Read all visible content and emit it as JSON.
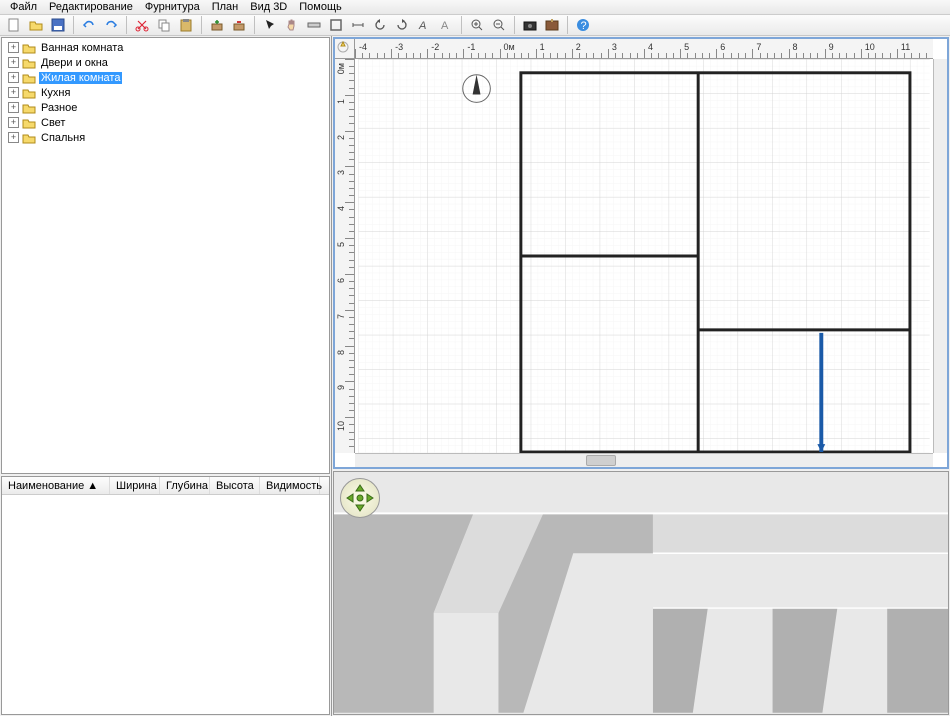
{
  "menu": {
    "file": "Файл",
    "edit": "Редактирование",
    "furniture": "Фурнитура",
    "plan": "План",
    "view3d": "Вид 3D",
    "help": "Помощь"
  },
  "tree": {
    "items": [
      {
        "label": "Ванная комната"
      },
      {
        "label": "Двери и окна"
      },
      {
        "label": "Жилая комната",
        "selected": true
      },
      {
        "label": "Кухня"
      },
      {
        "label": "Разное"
      },
      {
        "label": "Свет"
      },
      {
        "label": "Спальня"
      }
    ]
  },
  "props": {
    "cols": {
      "name": "Наименование ▲",
      "width": "Ширина",
      "depth": "Глубина",
      "height": "Высота",
      "vis": "Видимость"
    }
  },
  "ruler": {
    "h": [
      "-4",
      "-3",
      "-2",
      "-1",
      "0м",
      "1",
      "2",
      "3",
      "4",
      "5",
      "6",
      "7",
      "8",
      "9",
      "10",
      "11"
    ],
    "v": [
      "0м",
      "1",
      "2",
      "3",
      "4",
      "5",
      "6",
      "7",
      "8",
      "9",
      "10"
    ]
  },
  "icons": {
    "new": "new",
    "open": "open",
    "save": "save",
    "undo": "undo",
    "redo": "redo",
    "cut": "cut",
    "copy": "copy",
    "paste": "paste",
    "add": "add",
    "delete": "delete",
    "select": "select",
    "pan": "pan",
    "wall": "wall",
    "room": "room",
    "dim": "dim",
    "rotL": "rotL",
    "rotR": "rotR",
    "text": "text",
    "import": "import",
    "zoomin": "zoomin",
    "zoomout": "zoomout",
    "photo": "photo",
    "pref": "pref",
    "helpq": "helpq"
  }
}
